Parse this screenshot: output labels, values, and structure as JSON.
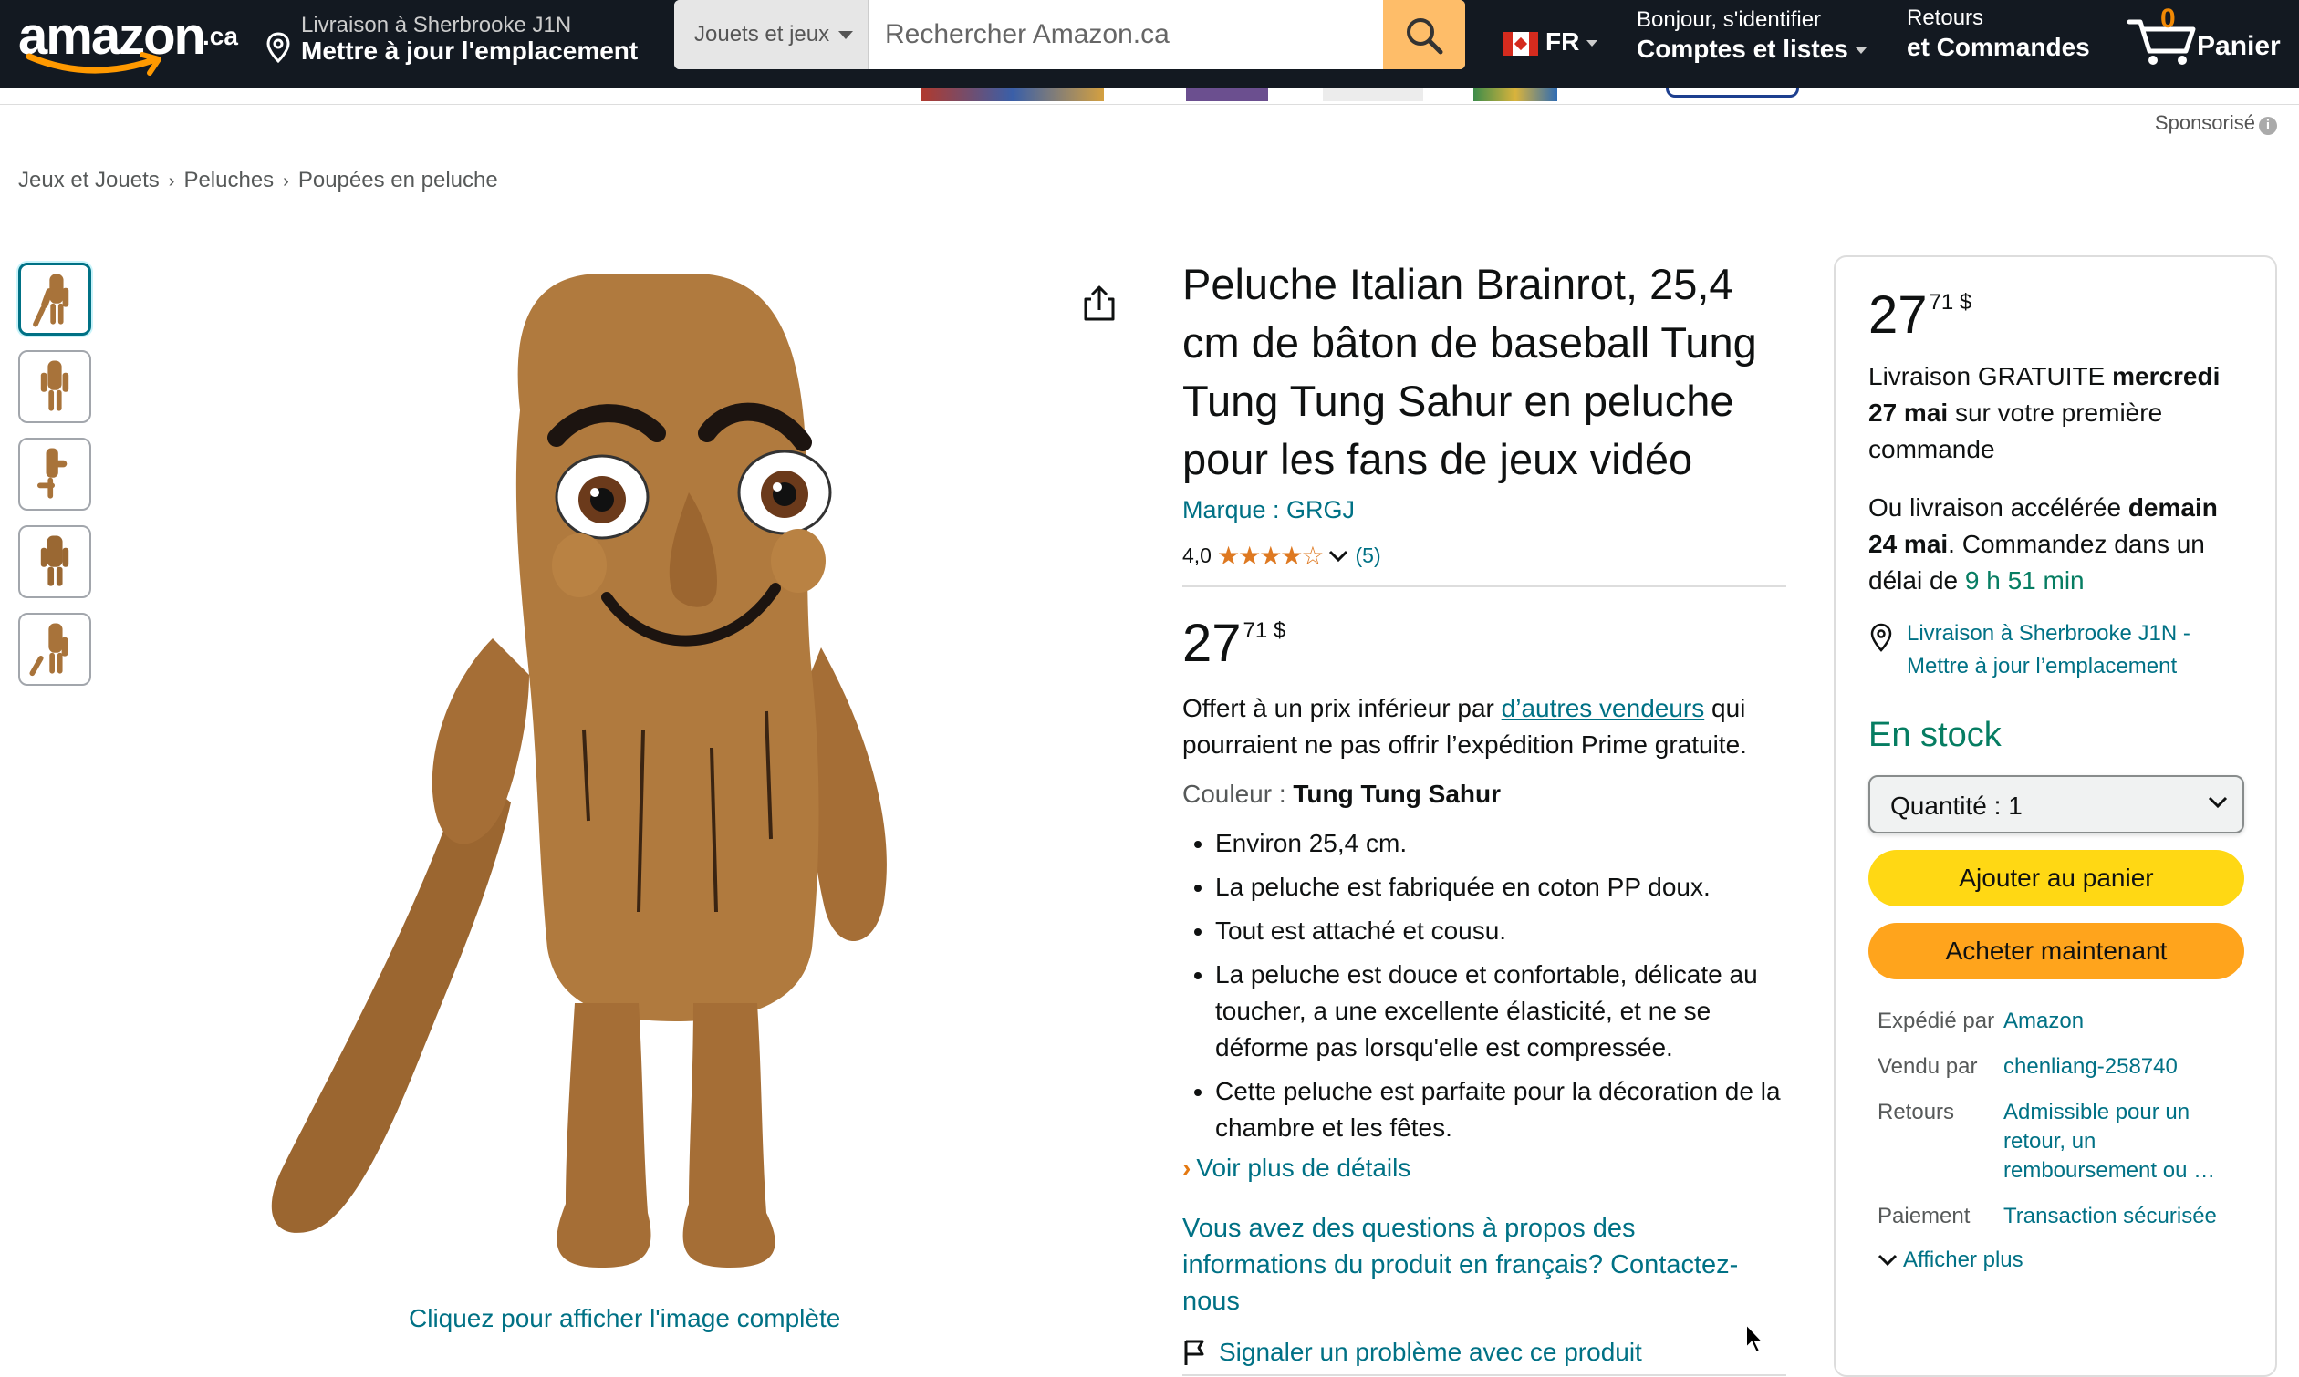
{
  "nav": {
    "logo_text": "amazon",
    "logo_suffix": ".ca",
    "deliver_line1": "Livraison à Sherbrooke J1N",
    "deliver_line2": "Mettre à jour l'emplacement",
    "search_category": "Jouets et jeux",
    "search_placeholder": "Rechercher Amazon.ca",
    "language": "FR",
    "account_line1": "Bonjour, s'identifier",
    "account_line2": "Comptes et listes",
    "returns_line1": "Retours",
    "returns_line2": "et Commandes",
    "cart_count": "0",
    "cart_label": "Panier"
  },
  "sponsored_label": "Sponsorisé",
  "breadcrumb": [
    "Jeux et Jouets",
    "Peluches",
    "Poupées en peluche"
  ],
  "image_caption": "Cliquez pour afficher l'image complète",
  "product": {
    "title": "Peluche Italian Brainrot, 25,4 cm de bâton de baseball Tung Tung Tung Sahur en peluche pour les fans de jeux vidéo",
    "brand": "Marque : GRGJ",
    "rating_value": "4,0",
    "rating_stars": 4,
    "rating_count": "(5)",
    "price_whole": "27",
    "price_fraction": "71",
    "price_currency": "$",
    "offer_prefix": "Offert à un prix inférieur par ",
    "offer_link": "d’autres vendeurs",
    "offer_suffix": " qui pourraient ne pas offrir l’expédition Prime gratuite.",
    "color_label": "Couleur : ",
    "color_value": "Tung Tung Sahur",
    "bullets": [
      "Environ 25,4 cm.",
      "La peluche est fabriquée en coton PP doux.",
      "Tout est attaché et cousu.",
      "La peluche est douce et confortable, délicate au toucher, a une excellente élasticité, et ne se déforme pas lorsqu'elle est compressée.",
      "Cette peluche est parfaite pour la décoration de la chambre et les fêtes."
    ],
    "more_details": "Voir plus de détails",
    "questions": "Vous avez des questions à propos des informations du produit en français? Contactez-nous",
    "report": "Signaler un problème avec ce produit"
  },
  "buybox": {
    "price_whole": "27",
    "price_fraction": "71",
    "price_currency": "$",
    "delivery_prefix": "Livraison GRATUITE ",
    "delivery_date": "mercredi 27 mai",
    "delivery_suffix": " sur votre première commande",
    "fast_prefix": "Ou livraison accélérée ",
    "fast_date": "demain 24 mai",
    "fast_mid": ". Commandez dans un délai de ",
    "fast_time": "9 h 51 min",
    "location": "Livraison à Sherbrooke J1N - Mettre à jour l’emplacement",
    "stock": "En stock",
    "quantity_label": "Quantité : ",
    "quantity_value": "1",
    "add_to_cart": "Ajouter au panier",
    "buy_now": "Acheter maintenant",
    "details": [
      {
        "key": "Expédié par",
        "value": "Amazon"
      },
      {
        "key": "Vendu par",
        "value": "chenliang-258740"
      },
      {
        "key": "Retours",
        "value": "Admissible pour un retour, un remboursement ou …"
      },
      {
        "key": "Paiement",
        "value": "Transaction sécurisée"
      }
    ],
    "show_more": "Afficher plus"
  },
  "colors": {
    "nav_bg": "#131921",
    "link": "#007185",
    "cart_button": "#ffd814",
    "buy_button": "#ffa41c",
    "in_stock": "#067d62",
    "star": "#de7921"
  }
}
